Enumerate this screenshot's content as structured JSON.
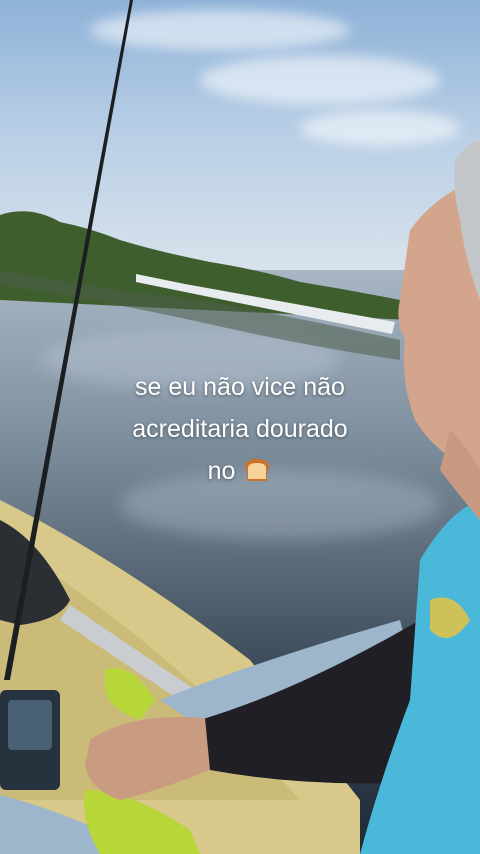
{
  "caption": {
    "line1": "se eu não vice não",
    "line2": "acreditaria dourado",
    "line3_text": "no",
    "line3_emoji_icon": "bread-icon"
  },
  "colors": {
    "sky": "#b9cfe6",
    "water": "#3a4856",
    "kayak": "#d8c98a",
    "shirt": "#4ab8d8",
    "caption_text": "#ffffff"
  }
}
